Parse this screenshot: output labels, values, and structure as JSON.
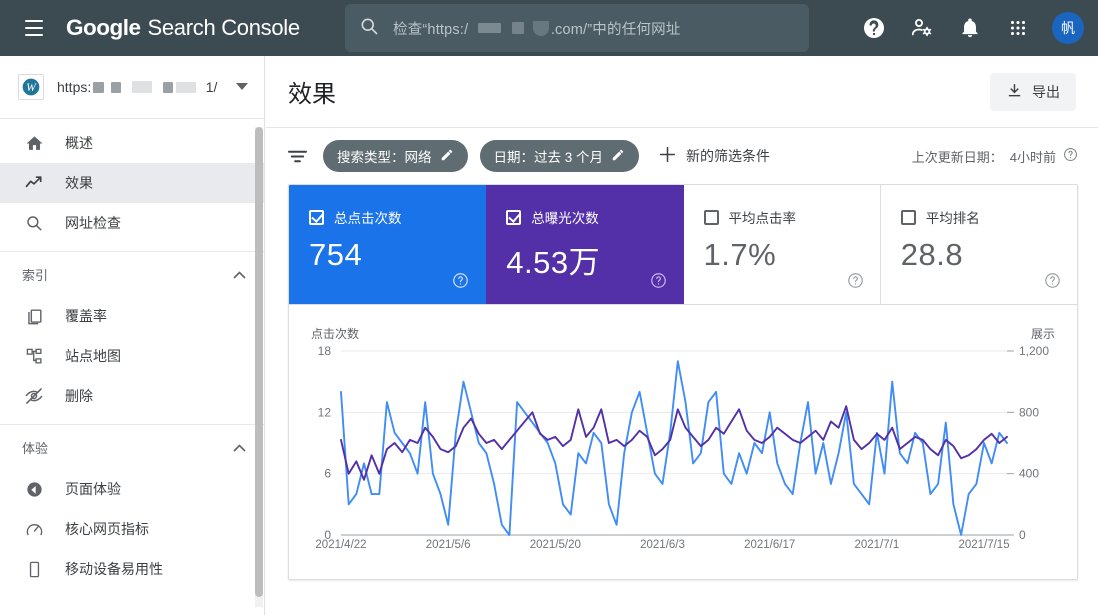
{
  "topbar": {
    "menu_icon": "hamburger-icon",
    "brand_google": "Google",
    "brand_product": "Search Console",
    "search": {
      "icon": "search-icon",
      "placeholder_prefix": "检查“https:/",
      "placeholder_suffix": ".com/”中的任何网址"
    },
    "icons": [
      "help-icon",
      "account-settings-icon",
      "notifications-bell-icon",
      "apps-grid-icon"
    ],
    "avatar_initial": "帆",
    "colors": {
      "bar_bg": "#3c4b52",
      "search_bg": "#4a5b63",
      "avatar_bg": "#1a65c0"
    }
  },
  "sidebar": {
    "property": {
      "icon": "wordpress-icon",
      "url_prefix": "https:",
      "url_suffix": "1/",
      "caret": "chevron-down-icon"
    },
    "items": [
      {
        "label": "概述",
        "icon": "home-icon",
        "active": false
      },
      {
        "label": "效果",
        "icon": "trending-up-icon",
        "active": true
      },
      {
        "label": "网址检查",
        "icon": "search-icon",
        "active": false
      }
    ],
    "groups": [
      {
        "title": "索引",
        "caret": "chevron-up-icon",
        "items": [
          {
            "label": "覆盖率",
            "icon": "pages-copy-icon"
          },
          {
            "label": "站点地图",
            "icon": "sitemap-icon"
          },
          {
            "label": "删除",
            "icon": "eye-off-icon"
          }
        ]
      },
      {
        "title": "体验",
        "caret": "chevron-up-icon",
        "items": [
          {
            "label": "页面体验",
            "icon": "page-experience-icon"
          },
          {
            "label": "核心网页指标",
            "icon": "core-web-vitals-icon"
          },
          {
            "label": "移动设备易用性",
            "icon": "mobile-device-icon"
          }
        ]
      }
    ]
  },
  "main": {
    "page_title": "效果",
    "export_label": "导出",
    "export_icon": "download-icon",
    "filters": {
      "funnel_icon": "filter-icon",
      "chips": [
        {
          "label": "搜索类型：网络",
          "edit_icon": "pencil-icon"
        },
        {
          "label": "日期：过去 3 个月",
          "edit_icon": "pencil-icon"
        }
      ],
      "new_filter_label": "新的筛选条件",
      "plus_icon": "plus-icon",
      "last_update_label": "上次更新日期：",
      "last_update_value": "4小时前",
      "help_icon": "help-circle-icon"
    },
    "metric_cards": [
      {
        "label": "总点击次数",
        "value": "754",
        "checked": true,
        "style": "clicks",
        "color": "#1a73e8",
        "help_icon": "help-circle-icon"
      },
      {
        "label": "总曝光次数",
        "value": "4.53万",
        "checked": true,
        "style": "impr",
        "color": "#5330a8",
        "help_icon": "help-circle-icon"
      },
      {
        "label": "平均点击率",
        "value": "1.7%",
        "checked": false,
        "style": "plain",
        "color": "#ffffff",
        "help_icon": "help-circle-icon"
      },
      {
        "label": "平均排名",
        "value": "28.8",
        "checked": false,
        "style": "plain",
        "color": "#ffffff",
        "help_icon": "help-circle-icon"
      }
    ]
  },
  "chart_data": {
    "type": "line",
    "title": "",
    "ylabel": "点击次数",
    "y2label": "展示",
    "xlabel": "",
    "grid": true,
    "legend_position": "none",
    "ylim": [
      0,
      18
    ],
    "y2lim": [
      0,
      1200
    ],
    "yticks": [
      "0",
      "6",
      "12",
      "18"
    ],
    "y2ticks": [
      "0",
      "400",
      "800",
      "1,200"
    ],
    "xticks": [
      "2021/4/22",
      "2021/5/6",
      "2021/5/20",
      "2021/6/3",
      "2021/6/17",
      "2021/7/1",
      "2021/7/15"
    ],
    "x_start": "2021/4/22",
    "x_end": "2021/7/20",
    "series": [
      {
        "name": "总点击次数",
        "color": "#3f8df5",
        "axis": "left",
        "values": [
          14,
          3,
          4,
          7,
          4,
          4,
          13,
          10,
          9,
          8,
          6,
          13,
          6,
          4,
          1,
          10,
          15,
          12,
          9,
          8,
          5,
          1,
          0,
          13,
          12,
          11,
          10,
          9,
          7,
          3,
          2,
          8,
          7,
          10,
          9,
          3,
          1,
          8,
          12,
          14,
          10,
          6,
          5,
          10,
          17,
          13,
          7,
          8,
          13,
          14,
          6,
          5,
          8,
          6,
          9,
          8,
          12,
          7,
          5,
          4,
          9,
          13,
          6,
          9,
          5,
          8,
          12,
          5,
          4,
          3,
          10,
          6,
          15,
          8,
          7,
          10,
          9,
          4,
          5,
          11,
          3,
          0,
          4,
          5,
          9,
          7,
          10,
          9
        ]
      },
      {
        "name": "总曝光次数",
        "color": "#5330a8",
        "axis": "right",
        "values": [
          620,
          400,
          480,
          360,
          520,
          400,
          560,
          600,
          540,
          620,
          600,
          700,
          640,
          560,
          540,
          580,
          700,
          760,
          660,
          600,
          620,
          560,
          620,
          680,
          740,
          800,
          660,
          620,
          640,
          580,
          620,
          820,
          640,
          700,
          820,
          600,
          620,
          580,
          620,
          680,
          640,
          520,
          560,
          620,
          820,
          700,
          640,
          580,
          620,
          700,
          660,
          740,
          820,
          680,
          620,
          600,
          640,
          700,
          660,
          620,
          600,
          640,
          680,
          620,
          740,
          700,
          840,
          620,
          560,
          600,
          660,
          620,
          700,
          560,
          600,
          640,
          620,
          560,
          520,
          620,
          580,
          500,
          520,
          560,
          620,
          660,
          600,
          640
        ]
      }
    ]
  }
}
